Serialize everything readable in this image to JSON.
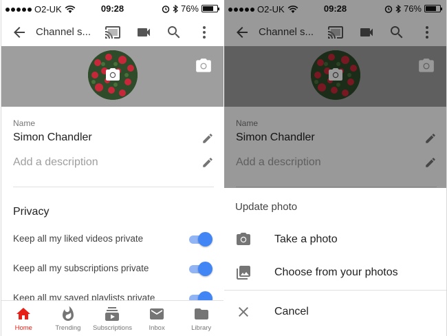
{
  "status_bar": {
    "carrier": "O2-UK",
    "time": "09:28",
    "battery": "76%",
    "battery_level": 0.76
  },
  "app_bar": {
    "title": "Channel s..."
  },
  "fields": {
    "name_label": "Name",
    "name_value": "Simon Chandler",
    "description_placeholder": "Add a description"
  },
  "privacy": {
    "title": "Privacy",
    "toggles": [
      {
        "label": "Keep all my liked videos private",
        "on": true
      },
      {
        "label": "Keep all my subscriptions private",
        "on": true
      },
      {
        "label": "Keep all my saved playlists private",
        "on": true
      }
    ]
  },
  "bottom_nav": {
    "items": [
      {
        "label": "Home",
        "icon": "home-icon",
        "active": true
      },
      {
        "label": "Trending",
        "icon": "trending-icon",
        "active": false
      },
      {
        "label": "Subscriptions",
        "icon": "subscriptions-icon",
        "active": false
      },
      {
        "label": "Inbox",
        "icon": "inbox-icon",
        "active": false
      },
      {
        "label": "Library",
        "icon": "library-icon",
        "active": false
      }
    ]
  },
  "update_sheet": {
    "title": "Update photo",
    "items": [
      {
        "label": "Take a photo",
        "icon": "camera-icon"
      },
      {
        "label": "Choose from your photos",
        "icon": "photo-library-icon"
      }
    ],
    "cancel_label": "Cancel"
  },
  "colors": {
    "accent": "#4285f4",
    "youtube_red": "#e62117",
    "banner": "#9e9e9e"
  }
}
